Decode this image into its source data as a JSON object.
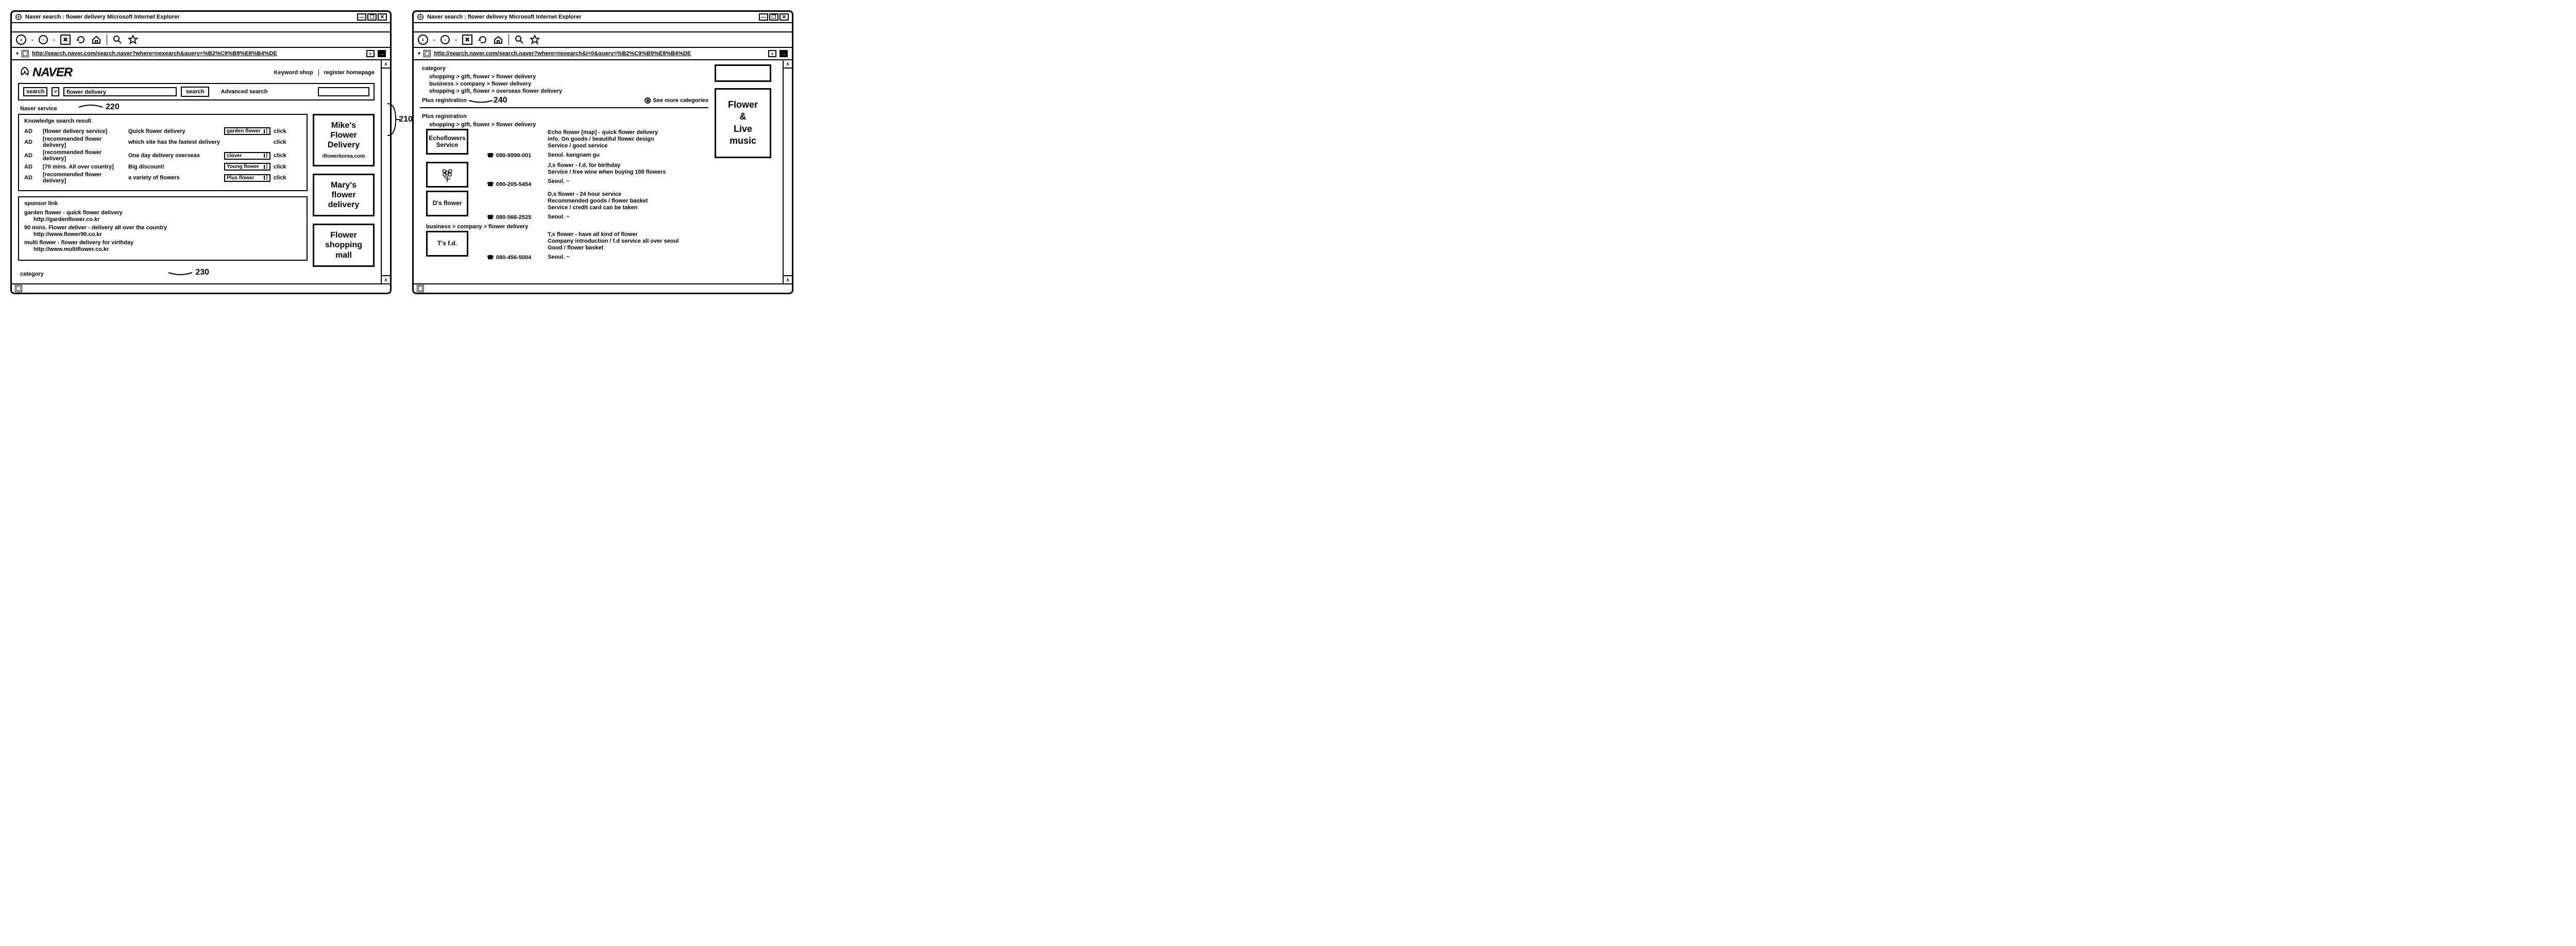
{
  "w1": {
    "title": "Naver search : flower delivery Microsoft Internet Explorer",
    "url": "http://search.naver.com/search.naver?where=nexearch&query=%B2%C9%B9%E8%B4%DE",
    "logo": "NAVER",
    "top_links": {
      "a": "Keyword shop",
      "b": "register homepage"
    },
    "search": {
      "dd": "search",
      "query": "flower delivery",
      "btn": "search",
      "adv": "Advanced search"
    },
    "naver_service": "Naver service",
    "knowledge": {
      "title": "Knowledge search result",
      "rows": [
        {
          "ad": "AD",
          "l": "[flower delivery service]",
          "r": "Quick flower delivery",
          "btn": "garden flower",
          "click": "click"
        },
        {
          "ad": "AD",
          "l": "[recommended flower delivery]",
          "r": "which site has the fastest delivery",
          "btn": "",
          "click": "click"
        },
        {
          "ad": "AD",
          "l": "[recommended flower delivery]",
          "r": "One day delivery overseas",
          "btn": "clover",
          "click": "click"
        },
        {
          "ad": "AD",
          "l": "[70 mins. All over country]",
          "r": "Big discount!",
          "btn": "Young flower",
          "click": "click"
        },
        {
          "ad": "AD",
          "l": "[recommended flower delivery]",
          "r": "a variety of flowers",
          "btn": "Plus flower",
          "click": "click"
        }
      ]
    },
    "sponsor": {
      "title": "sponsor link",
      "items": [
        {
          "t": "garden flower - quick flower delivery",
          "u": "http://gardenflower.co.kr"
        },
        {
          "t": "90 mins. Flower deliver - delivery all over the country",
          "u": "http://www.flower90.co.kr"
        },
        {
          "t": "multi flower - flower delivery for virthday",
          "u": "http://www.multiflower.co.kr"
        }
      ]
    },
    "category": "category",
    "ads": [
      {
        "t1": "Mike's",
        "t2": "Flower",
        "t3": "Delivery",
        "sub": "iflowerkorea.com"
      },
      {
        "t1": "Mary's",
        "t2": "flower",
        "t3": "delivery",
        "sub": ""
      },
      {
        "t1": "Flower",
        "t2": "shopping",
        "t3": "mall",
        "sub": ""
      }
    ],
    "callouts": {
      "c220": "220",
      "c210": "210",
      "c230": "230"
    }
  },
  "w2": {
    "title": "Naver search : flower delivery Microsoft Internet Explorer",
    "url": "http://search.naver.com/search.naver?where=nexearch&j=0&query=%B2%C9%B9%E8%B4%DE",
    "category": "category",
    "cats": [
      "shopping > gift, flower > flower delivery",
      "business > company > flower delivery",
      "shopping > gift, flower > overseas flower delivery"
    ],
    "plus_reg": "Plus registration",
    "see_more": "See more categories",
    "callout240": "240",
    "section2": "Plus registration",
    "subcat1": "shopping > gift, flower > flower delivery",
    "subcat2": "business > company > flower delivery",
    "listings": [
      {
        "thumb": "Echoflowers Service",
        "phone": "080-9999-001",
        "lines": [
          "Echo flower [map] - quick flower delivery",
          "info. On goods / beautiful flower design",
          "Service / good service"
        ],
        "loc": "Seoul. kangnam gu"
      },
      {
        "thumb": "",
        "phone": "080-205-5454",
        "lines": [
          "J,s flower - f.d. for birthday",
          "Service / free wine when buying 100 flowers"
        ],
        "loc": "Seoul. ~"
      },
      {
        "thumb": "D's flower",
        "phone": "080-566-2525",
        "lines": [
          "D,s flower - 24 hour service",
          "Recommended goods / flower basket",
          "Service / credit card can be taken"
        ],
        "loc": "Seoul. ~"
      },
      {
        "thumb": "T's f.d.",
        "phone": "080-456-5004",
        "lines": [
          "T,s flower - have all kind of flower",
          "Company introduction / f.d service all over seoul",
          "Good / flower basket"
        ],
        "loc": "Seoul. ~"
      }
    ],
    "side_ad": {
      "l1": "Flower",
      "l2": "&",
      "l3": "Live music"
    }
  }
}
